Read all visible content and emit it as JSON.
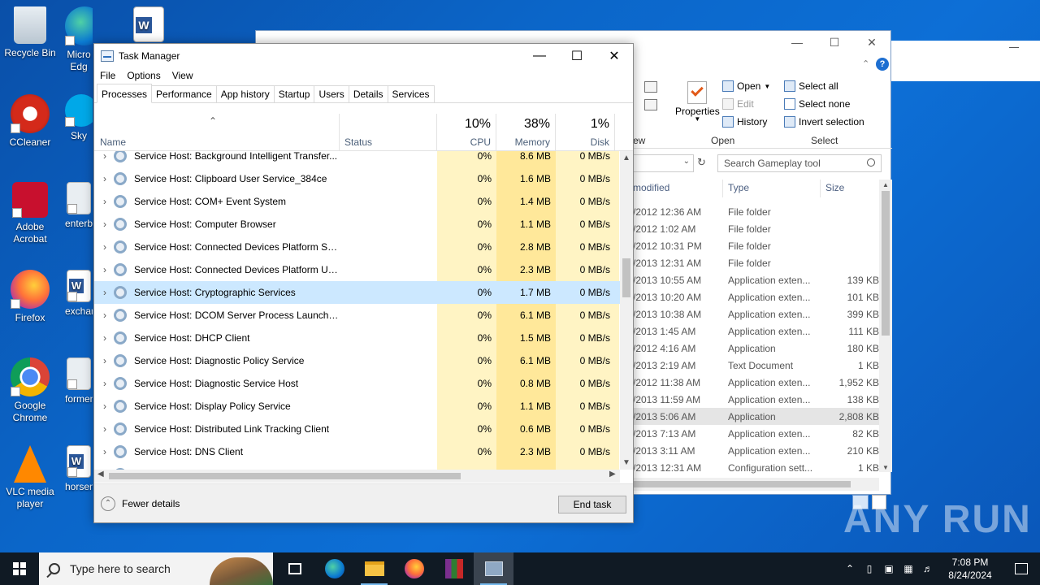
{
  "desktop": {
    "icons": [
      {
        "label": "Recycle Bin"
      },
      {
        "label": "Micro Edg"
      },
      {
        "label": "CCleaner"
      },
      {
        "label": "Sky"
      },
      {
        "label": "Adobe Acrobat"
      },
      {
        "label": "enterbe"
      },
      {
        "label": "Firefox"
      },
      {
        "label": "exchan"
      },
      {
        "label": "Google Chrome"
      },
      {
        "label": "formen"
      },
      {
        "label": "VLC media player"
      },
      {
        "label": "horsem"
      }
    ]
  },
  "explorer": {
    "ribbon": {
      "open": "Open",
      "edit": "Edit",
      "history": "History",
      "properties": "Properties",
      "select_all": "Select all",
      "select_none": "Select none",
      "invert_selection": "Invert selection",
      "group_open": "Open",
      "group_select": "Select",
      "group_new_partial": "ew"
    },
    "search_placeholder": "Search Gameplay tool",
    "columns": {
      "modified": "modified",
      "type": "Type",
      "size": "Size"
    },
    "rows": [
      {
        "date": "/2012 12:36 AM",
        "type": "File folder",
        "size": ""
      },
      {
        "date": "/2012 1:02 AM",
        "type": "File folder",
        "size": ""
      },
      {
        "date": "/2012 10:31 PM",
        "type": "File folder",
        "size": ""
      },
      {
        "date": "/2013 12:31 AM",
        "type": "File folder",
        "size": ""
      },
      {
        "date": "/2013 10:55 AM",
        "type": "Application exten...",
        "size": "139 KB"
      },
      {
        "date": "/2013 10:20 AM",
        "type": "Application exten...",
        "size": "101 KB"
      },
      {
        "date": "/2013 10:38 AM",
        "type": "Application exten...",
        "size": "399 KB"
      },
      {
        "date": "/2013 1:45 AM",
        "type": "Application exten...",
        "size": "111 KB"
      },
      {
        "date": "/2012 4:16 AM",
        "type": "Application",
        "size": "180 KB"
      },
      {
        "date": "/2013 2:19 AM",
        "type": "Text Document",
        "size": "1 KB"
      },
      {
        "date": "/2012 11:38 AM",
        "type": "Application exten...",
        "size": "1,952 KB"
      },
      {
        "date": "/2013 11:59 AM",
        "type": "Application exten...",
        "size": "138 KB"
      },
      {
        "date": "/2013 5:06 AM",
        "type": "Application",
        "size": "2,808 KB"
      },
      {
        "date": "/2013 7:13 AM",
        "type": "Application exten...",
        "size": "82 KB"
      },
      {
        "date": "/2013 3:11 AM",
        "type": "Application exten...",
        "size": "210 KB"
      },
      {
        "date": "/2013 12:31 AM",
        "type": "Configuration sett...",
        "size": "1 KB"
      }
    ]
  },
  "taskmanager": {
    "title": "Task Manager",
    "menu": [
      "File",
      "Options",
      "View"
    ],
    "tabs": [
      "Processes",
      "Performance",
      "App history",
      "Startup",
      "Users",
      "Details",
      "Services"
    ],
    "columns": {
      "name": "Name",
      "status": "Status",
      "cpu": {
        "pct": "10%",
        "label": "CPU"
      },
      "memory": {
        "pct": "38%",
        "label": "Memory"
      },
      "disk": {
        "pct": "1%",
        "label": "Disk"
      }
    },
    "processes": [
      {
        "name": "Service Host: Background Intelligent Transfer...",
        "cpu": "0%",
        "mem": "8.6 MB",
        "disk": "0 MB/s"
      },
      {
        "name": "Service Host: Clipboard User Service_384ce",
        "cpu": "0%",
        "mem": "1.6 MB",
        "disk": "0 MB/s"
      },
      {
        "name": "Service Host: COM+ Event System",
        "cpu": "0%",
        "mem": "1.4 MB",
        "disk": "0 MB/s"
      },
      {
        "name": "Service Host: Computer Browser",
        "cpu": "0%",
        "mem": "1.1 MB",
        "disk": "0 MB/s"
      },
      {
        "name": "Service Host: Connected Devices Platform Se...",
        "cpu": "0%",
        "mem": "2.8 MB",
        "disk": "0 MB/s"
      },
      {
        "name": "Service Host: Connected Devices Platform Us...",
        "cpu": "0%",
        "mem": "2.3 MB",
        "disk": "0 MB/s"
      },
      {
        "name": "Service Host: Cryptographic Services",
        "cpu": "0%",
        "mem": "1.7 MB",
        "disk": "0 MB/s"
      },
      {
        "name": "Service Host: DCOM Server Process Launcher...",
        "cpu": "0%",
        "mem": "6.1 MB",
        "disk": "0 MB/s"
      },
      {
        "name": "Service Host: DHCP Client",
        "cpu": "0%",
        "mem": "1.5 MB",
        "disk": "0 MB/s"
      },
      {
        "name": "Service Host: Diagnostic Policy Service",
        "cpu": "0%",
        "mem": "6.1 MB",
        "disk": "0 MB/s"
      },
      {
        "name": "Service Host: Diagnostic Service Host",
        "cpu": "0%",
        "mem": "0.8 MB",
        "disk": "0 MB/s"
      },
      {
        "name": "Service Host: Display Policy Service",
        "cpu": "0%",
        "mem": "1.1 MB",
        "disk": "0 MB/s"
      },
      {
        "name": "Service Host: Distributed Link Tracking Client",
        "cpu": "0%",
        "mem": "0.6 MB",
        "disk": "0 MB/s"
      },
      {
        "name": "Service Host: DNS Client",
        "cpu": "0%",
        "mem": "2.3 MB",
        "disk": "0 MB/s"
      }
    ],
    "footer": {
      "fewer_details": "Fewer details",
      "end_task": "End task"
    }
  },
  "watermark": "ANY RUN",
  "taskbar": {
    "search_placeholder": "Type here to search",
    "time": "7:08 PM",
    "date": "8/24/2024"
  },
  "colors": {
    "selection": "#cce8ff",
    "cpu_heat": "#fff4c4",
    "mem_heat": "#ffe89a",
    "taskbar": "#101a24"
  }
}
